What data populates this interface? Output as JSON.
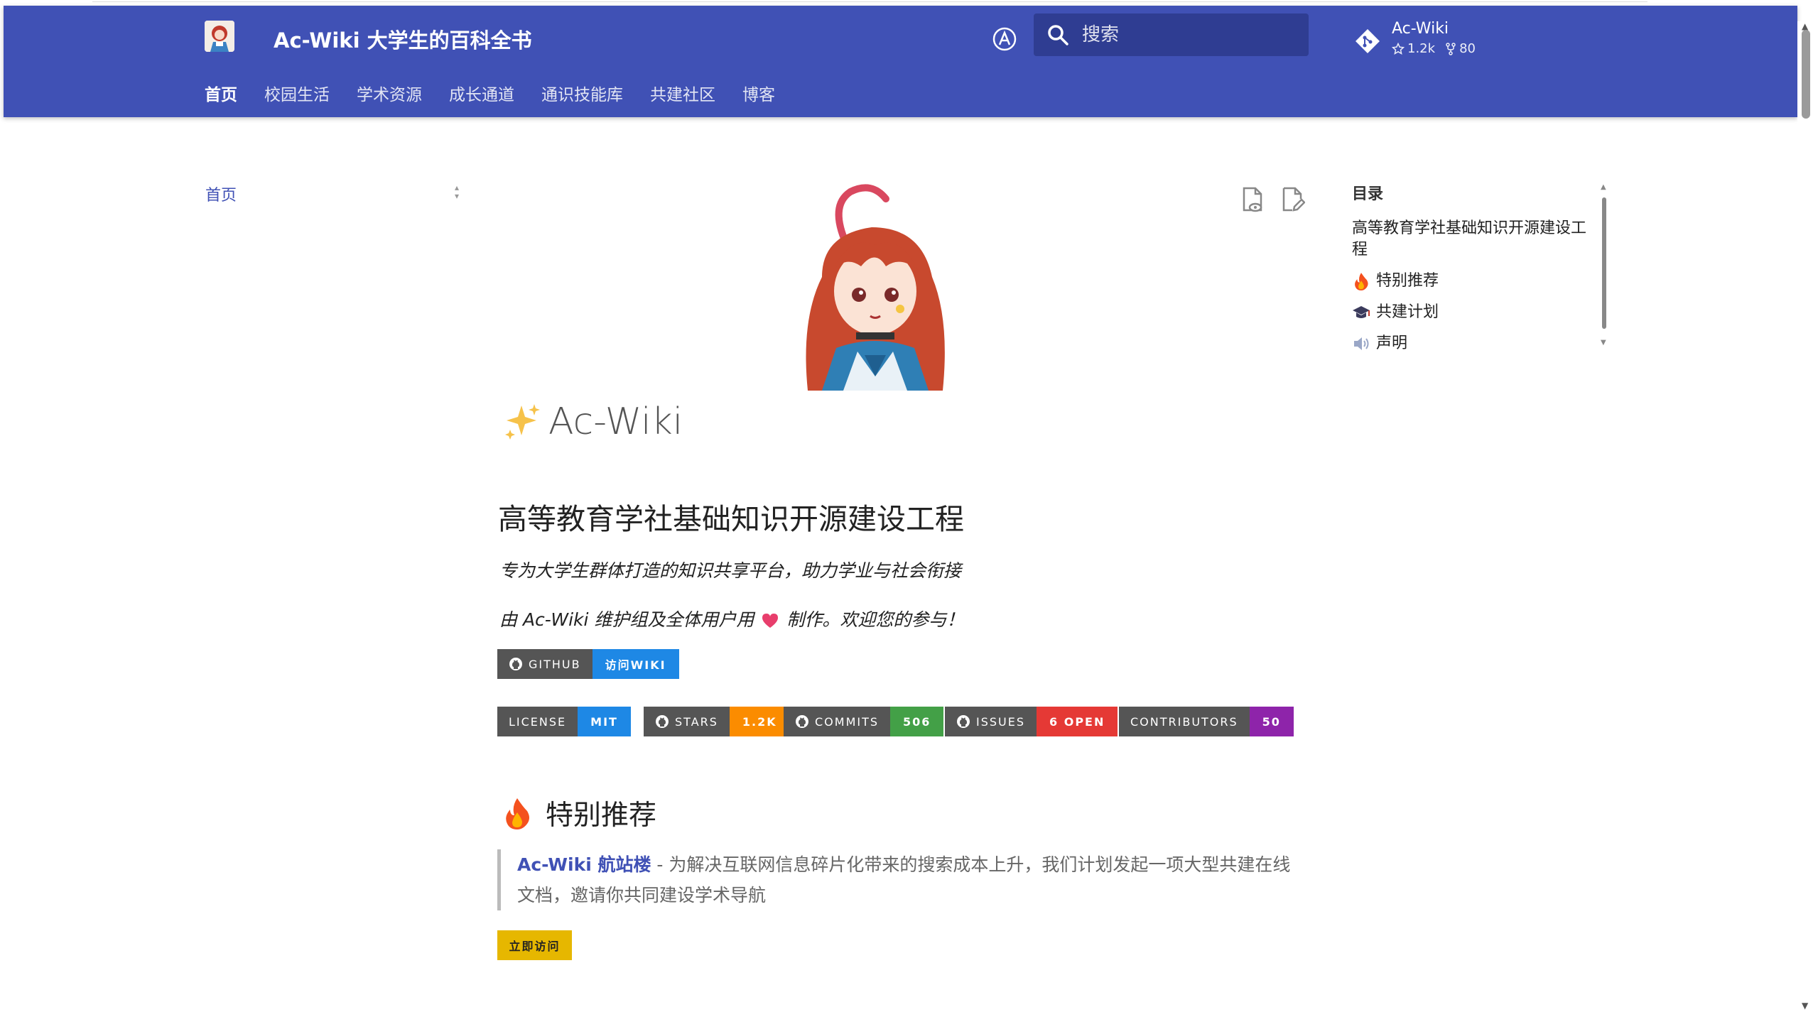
{
  "header": {
    "site_title": "Ac-Wiki 大学生的百科全书",
    "search_placeholder": "搜索",
    "repo": {
      "name": "Ac-Wiki",
      "stars": "1.2k",
      "forks": "80"
    },
    "tabs": [
      {
        "label": "首页",
        "active": true
      },
      {
        "label": "校园生活",
        "active": false
      },
      {
        "label": "学术资源",
        "active": false
      },
      {
        "label": "成长通道",
        "active": false
      },
      {
        "label": "通识技能库",
        "active": false
      },
      {
        "label": "共建社区",
        "active": false
      },
      {
        "label": "博客",
        "active": false
      }
    ]
  },
  "leftnav": {
    "home": "首页"
  },
  "content": {
    "h1": "Ac-Wiki",
    "h2": "高等教育学社基础知识开源建设工程",
    "tagline": "专为大学生群体打造的知识共享平台，助力学业与社会衔接",
    "credit_before": "由 Ac-Wiki 维护组及全体用户用",
    "credit_after": "制作。欢迎您的参与！",
    "cta_badge": {
      "left": "GITHUB",
      "right": "访问WIKI"
    },
    "badges": [
      {
        "label": "LICENSE",
        "value": "MIT",
        "color": "#1e88e5",
        "github": false
      },
      {
        "label": "STARS",
        "value": "1.2K",
        "color": "#fb8c00",
        "github": true
      },
      {
        "label": "COMMITS",
        "value": "506",
        "color": "#43a047",
        "github": true
      },
      {
        "label": "ISSUES",
        "value": "6 OPEN",
        "color": "#e53935",
        "github": true
      },
      {
        "label": "CONTRIBUTORS",
        "value": "50",
        "color": "#8e24aa",
        "github": false
      }
    ],
    "section_title": "特别推荐",
    "quote_link": "Ac-Wiki 航站楼",
    "quote_text": " - 为解决互联网信息碎片化带来的搜索成本上升，我们计划发起一项大型共建在线文档，邀请你共同建设学术导航",
    "visit_button": "立即访问"
  },
  "toc": {
    "title": "目录",
    "items": [
      {
        "label": "高等教育学社基础知识开源建设工程",
        "icon": "none"
      },
      {
        "label": "特别推荐",
        "icon": "fire-icon"
      },
      {
        "label": "共建计划",
        "icon": "graduation-cap-icon"
      },
      {
        "label": "声明",
        "icon": "speaker-icon"
      }
    ]
  },
  "colors": {
    "primary": "#4051b5",
    "search_bg": "#2f3d92",
    "accent_button": "#e6b700"
  }
}
